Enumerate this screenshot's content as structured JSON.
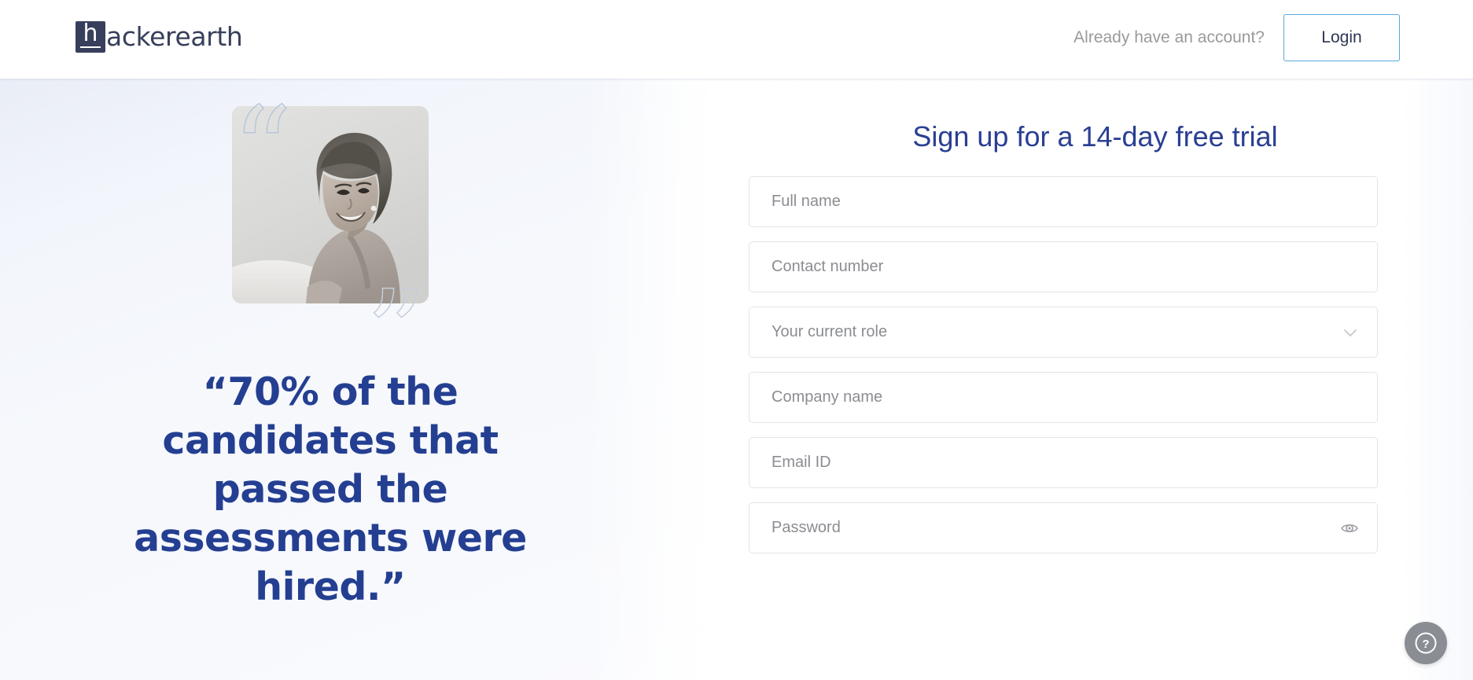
{
  "header": {
    "logo_glyph": "h",
    "logo_text": "ackerearth",
    "logo_name": "hackerearth",
    "have_account_text": "Already have an account?",
    "login_label": "Login",
    "login_border_color": "#59a9dd",
    "logo_color": "#383f5c"
  },
  "left": {
    "testimonial": "“70% of the candidates that passed the assessments were hired.”",
    "quote_open_glyph": "“",
    "quote_close_glyph": "”",
    "photo_alt": "Smiling woman portrait, grayscale",
    "testimonial_color": "#243f91",
    "quote_mark_color": "#b7c6dd"
  },
  "form": {
    "title": "Sign up for a 14-day free trial",
    "title_color": "#2a3f93",
    "fields": [
      {
        "name": "full-name",
        "placeholder": "Full name",
        "type": "text",
        "icon": ""
      },
      {
        "name": "contact-number",
        "placeholder": "Contact number",
        "type": "tel",
        "icon": ""
      },
      {
        "name": "current-role",
        "placeholder": "Your current role",
        "type": "select",
        "icon": "chevron-down-icon"
      },
      {
        "name": "company-name",
        "placeholder": "Company name",
        "type": "text",
        "icon": ""
      },
      {
        "name": "email-id",
        "placeholder": "Email ID",
        "type": "email",
        "icon": ""
      },
      {
        "name": "password",
        "placeholder": "Password",
        "type": "password",
        "icon": "eye-icon"
      }
    ]
  },
  "help": {
    "label": "?",
    "tooltip": "Help",
    "background_color": "#8a8e94"
  }
}
